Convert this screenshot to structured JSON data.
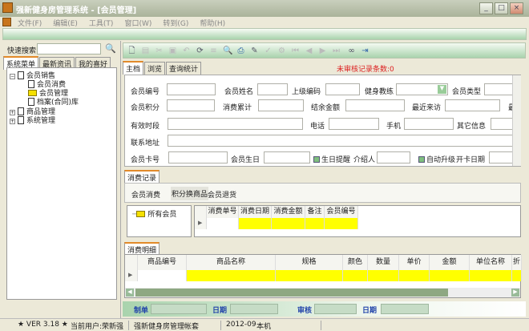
{
  "window": {
    "title": "强新健身房管理系统 - [会员管理]"
  },
  "menu": [
    "文件(F)",
    "编辑(E)",
    "工具(T)",
    "窗口(W)",
    "转到(G)",
    "帮助(H)"
  ],
  "left": {
    "search_label": "快速搜索",
    "search_value": "",
    "tabs": [
      "系统菜单",
      "最新资讯",
      "我的喜好"
    ],
    "tree": [
      {
        "label": "会员销售",
        "level": 0,
        "expanded": true
      },
      {
        "label": "会员消费",
        "level": 1
      },
      {
        "label": "会员管理",
        "level": 1,
        "selected": true
      },
      {
        "label": "档案(合同)库",
        "level": 1
      },
      {
        "label": "商品管理",
        "level": 0
      },
      {
        "label": "系统管理",
        "level": 0
      }
    ]
  },
  "main": {
    "tabs": [
      "主档",
      "浏览",
      "查询统计"
    ],
    "unreviewed": "未审核记录条数:0",
    "form": {
      "member_no": "会员编号",
      "member_name": "会员姓名",
      "parent_code": "上级编码",
      "coach": "健身教练",
      "member_type": "会员类型",
      "points": "会员积分",
      "total_spent": "消费累计",
      "balance": "结余金额",
      "last_visit": "最近来访",
      "cut": "最",
      "valid_period": "有效时段",
      "phone": "电话",
      "mobile": "手机",
      "other_info": "其它信息",
      "address": "联系地址",
      "card_no": "会员卡号",
      "birthday": "会员生日",
      "birthday_remind": "生日提醒",
      "referrer": "介绍人",
      "auto_upgrade": "自动升级",
      "open_date": "开卡日期"
    },
    "records": {
      "tab": "消费记录",
      "buttons": [
        "会员消费",
        "积分换商品",
        "会员退货"
      ],
      "tree_root": "所有会员",
      "columns": [
        "消费单号",
        "消费日期",
        "消费金额",
        "备注",
        "会员编号"
      ]
    },
    "details": {
      "tab": "消费明细",
      "columns": [
        "商品编号",
        "商品名称",
        "规格",
        "颜色",
        "数量",
        "单价",
        "金额",
        "单位名称",
        "折"
      ]
    },
    "footer": {
      "maker": "制单",
      "date1": "日期",
      "review": "审核",
      "date2": "日期"
    }
  },
  "status": {
    "version": "★ VER 3.18 ★",
    "user": "当前用户:荣新强",
    "account": "强新健身房管理帐套",
    "period": "2012-09",
    "machine": "本机"
  }
}
